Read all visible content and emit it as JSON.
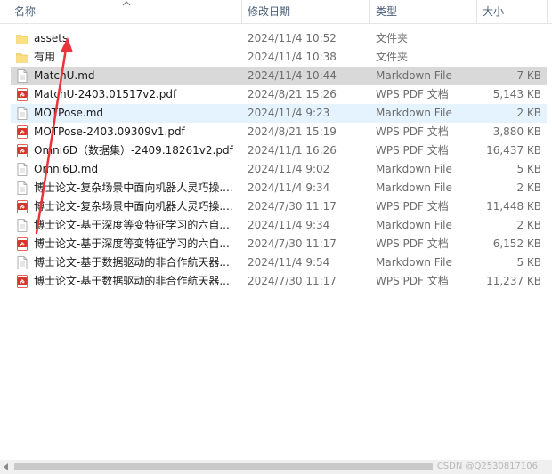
{
  "columns": {
    "name": "名称",
    "date": "修改日期",
    "type": "类型",
    "size": "大小"
  },
  "files": [
    {
      "name": "assets",
      "date": "2024/11/4 10:52",
      "type": "文件夹",
      "size": "",
      "icon": "folder-icon"
    },
    {
      "name": "有用",
      "date": "2024/11/4 10:38",
      "type": "文件夹",
      "size": "",
      "icon": "folder-icon"
    },
    {
      "name": "MatchU.md",
      "date": "2024/11/4 10:44",
      "type": "Markdown File",
      "size": "7 KB",
      "icon": "markdown-file-icon"
    },
    {
      "name": "MatchU-2403.01517v2.pdf",
      "date": "2024/8/21 15:26",
      "type": "WPS PDF 文档",
      "size": "5,143 KB",
      "icon": "pdf-file-icon"
    },
    {
      "name": "MOTPose.md",
      "date": "2024/11/4 9:23",
      "type": "Markdown File",
      "size": "2 KB",
      "icon": "markdown-file-icon"
    },
    {
      "name": "MOTPose-2403.09309v1.pdf",
      "date": "2024/8/21 15:19",
      "type": "WPS PDF 文档",
      "size": "3,880 KB",
      "icon": "pdf-file-icon"
    },
    {
      "name": "Omni6D（数据集）-2409.18261v2.pdf",
      "date": "2024/11/1 16:26",
      "type": "WPS PDF 文档",
      "size": "16,437 KB",
      "icon": "pdf-file-icon"
    },
    {
      "name": "Omni6D.md",
      "date": "2024/11/4 9:02",
      "type": "Markdown File",
      "size": "5 KB",
      "icon": "markdown-file-icon"
    },
    {
      "name": "博士论文-复杂场景中面向机器人灵巧操....",
      "date": "2024/11/4 9:34",
      "type": "Markdown File",
      "size": "2 KB",
      "icon": "markdown-file-icon"
    },
    {
      "name": "博士论文-复杂场景中面向机器人灵巧操....",
      "date": "2024/7/30 11:17",
      "type": "WPS PDF 文档",
      "size": "11,448 KB",
      "icon": "pdf-file-icon"
    },
    {
      "name": "博士论文-基于深度等变特征学习的六自...",
      "date": "2024/11/4 9:34",
      "type": "Markdown File",
      "size": "2 KB",
      "icon": "markdown-file-icon"
    },
    {
      "name": "博士论文-基于深度等变特征学习的六自...",
      "date": "2024/7/30 11:17",
      "type": "WPS PDF 文档",
      "size": "6,152 KB",
      "icon": "pdf-file-icon"
    },
    {
      "name": "博士论文-基于数据驱动的非合作航天器...",
      "date": "2024/11/4 9:54",
      "type": "Markdown File",
      "size": "5 KB",
      "icon": "markdown-file-icon"
    },
    {
      "name": "博士论文-基于数据驱动的非合作航天器...",
      "date": "2024/7/30 11:17",
      "type": "WPS PDF 文档",
      "size": "11,237 KB",
      "icon": "pdf-file-icon"
    }
  ],
  "selected_index": 2,
  "hover_index": 4,
  "watermark": "CSDN @Q2530817106",
  "colors": {
    "accent_arrow": "#e8343a",
    "selected_bg": "#d9d9d9",
    "hover_bg": "#e5f3ff",
    "folder": "#f8d775",
    "pdf": "#d9342b"
  }
}
